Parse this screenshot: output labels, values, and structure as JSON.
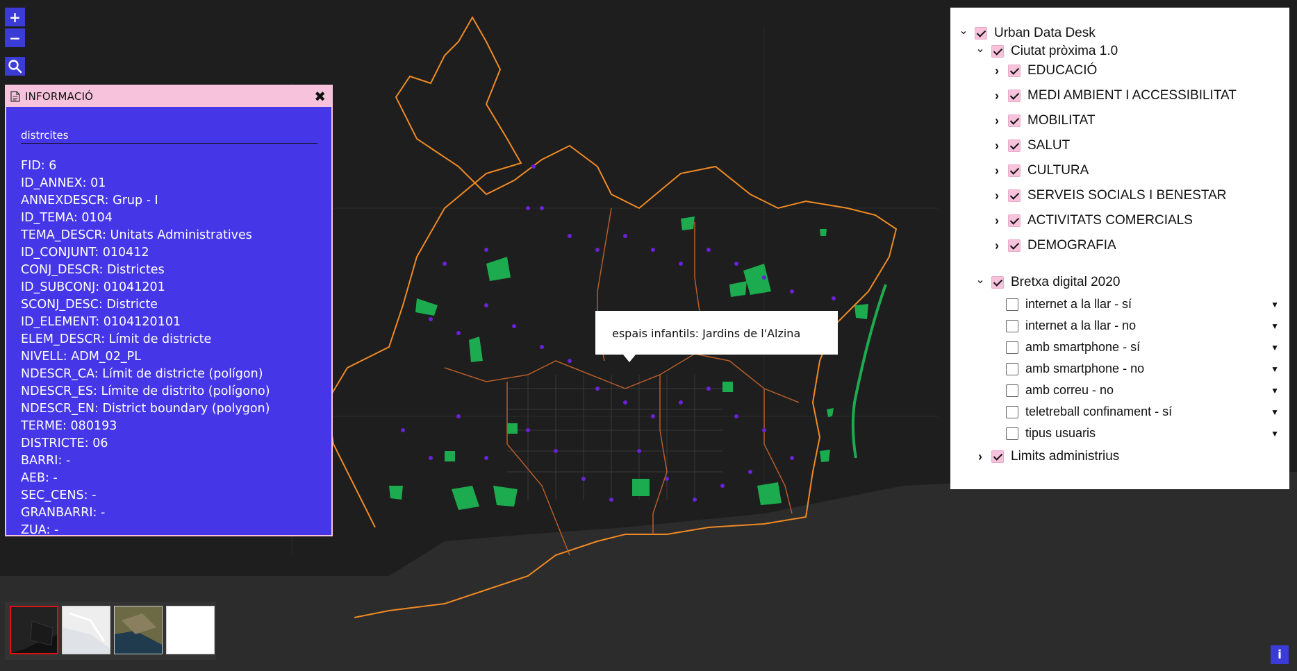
{
  "map": {
    "colors": {
      "background": "#1a1a1a",
      "boundary": "#f08a24",
      "parks": "#1dab4f",
      "points": "#6a22d8"
    }
  },
  "controls": {
    "zoom_in": "+",
    "zoom_out": "−",
    "info": "i"
  },
  "info_panel": {
    "title": "INFORMACIÓ",
    "layer": "distrcites",
    "attributes": [
      {
        "key": "FID:",
        "value": "6"
      },
      {
        "key": "ID_ANNEX:",
        "value": "01"
      },
      {
        "key": "ANNEXDESCR:",
        "value": "Grup - I"
      },
      {
        "key": "ID_TEMA:",
        "value": "0104"
      },
      {
        "key": "TEMA_DESCR:",
        "value": "Unitats Administratives"
      },
      {
        "key": "ID_CONJUNT:",
        "value": "010412"
      },
      {
        "key": "CONJ_DESCR:",
        "value": "Districtes"
      },
      {
        "key": "ID_SUBCONJ:",
        "value": "01041201"
      },
      {
        "key": "SCONJ_DESC:",
        "value": "Districte"
      },
      {
        "key": "ID_ELEMENT:",
        "value": "0104120101"
      },
      {
        "key": "ELEM_DESCR:",
        "value": "Límit de districte"
      },
      {
        "key": "NIVELL:",
        "value": "ADM_02_PL"
      },
      {
        "key": "NDESCR_CA:",
        "value": "Límit de districte (polígon)"
      },
      {
        "key": "NDESCR_ES:",
        "value": "Límite de distrito (polígono)"
      },
      {
        "key": "NDESCR_EN:",
        "value": "District boundary (polygon)"
      },
      {
        "key": "TERME:",
        "value": "080193"
      },
      {
        "key": "DISTRICTE:",
        "value": "06"
      },
      {
        "key": "BARRI:",
        "value": "-"
      },
      {
        "key": "AEB:",
        "value": "-"
      },
      {
        "key": "SEC_CENS:",
        "value": "-"
      },
      {
        "key": "GRANBARRI:",
        "value": "-"
      },
      {
        "key": "ZUA:",
        "value": "-"
      }
    ]
  },
  "popup": {
    "label": "espais infantils:",
    "value": "Jardins de l'Alzina"
  },
  "layer_tree": {
    "root": "Urban Data Desk",
    "groups": [
      {
        "name": "Ciutat pròxima 1.0",
        "children": [
          "EDUCACIÓ",
          "MEDI AMBIENT I ACCESSIBILITAT",
          "MOBILITAT",
          "SALUT",
          "CULTURA",
          "SERVEIS SOCIALS I BENESTAR",
          "ACTIVITATS COMERCIALS",
          "DEMOGRAFIA"
        ]
      },
      {
        "name": "Bretxa digital 2020",
        "children": [
          "internet a la llar - sí",
          "internet a la llar - no",
          "amb smartphone - sí",
          "amb smartphone - no",
          "amb correu - no",
          "teletreball confinament - sí",
          "tipus usuaris"
        ]
      },
      {
        "name": "Limits administrius"
      }
    ]
  },
  "basemaps": [
    "dark-basemap",
    "light-basemap",
    "satellite-basemap",
    "blank-basemap"
  ]
}
